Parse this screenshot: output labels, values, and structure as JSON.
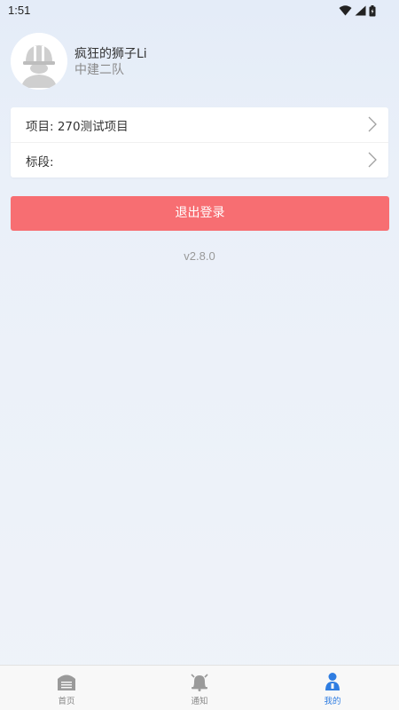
{
  "status_bar": {
    "time": "1:51",
    "icons": [
      "wifi-icon",
      "cellular-signal-icon",
      "battery-icon"
    ]
  },
  "profile": {
    "avatar_icon": "worker-helmet-avatar-icon",
    "user_name": "疯狂的狮子Li",
    "team_name": "中建二队"
  },
  "settings": {
    "project_label": "项目: 270测试项目",
    "section_label": "标段:"
  },
  "logout": {
    "label": "退出登录",
    "color": "#f76e72"
  },
  "version": "v2.8.0",
  "tabbar": {
    "active_color": "#2f7de1",
    "inactive_color": "#888888",
    "tabs": [
      {
        "label": "首页",
        "icon": "home-icon",
        "active": false
      },
      {
        "label": "通知",
        "icon": "bell-icon",
        "active": false
      },
      {
        "label": "我的",
        "icon": "person-icon",
        "active": true
      }
    ]
  }
}
